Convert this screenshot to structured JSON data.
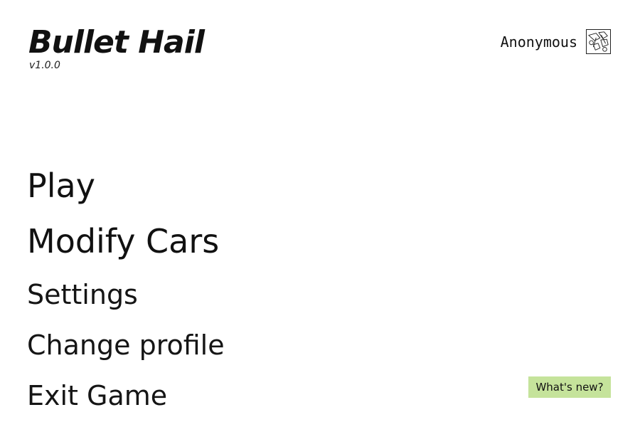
{
  "game": {
    "title": "Bullet Hail",
    "version": "v1.0.0"
  },
  "profile": {
    "name": "Anonymous",
    "avatar_icon": "doodle-avatar-icon"
  },
  "menu": {
    "items": [
      {
        "label": "Play"
      },
      {
        "label": "Modify Cars"
      },
      {
        "label": "Settings"
      },
      {
        "label": "Change profile"
      },
      {
        "label": "Exit Game"
      }
    ]
  },
  "whats_new": {
    "label": "What's new?",
    "color": "#c5e39b"
  }
}
